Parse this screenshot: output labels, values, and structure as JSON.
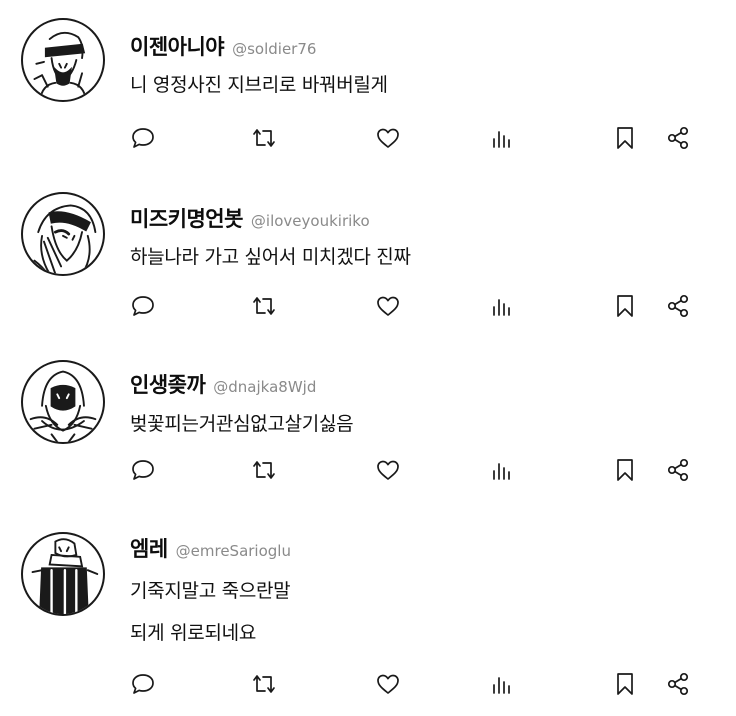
{
  "feed": {
    "posts": [
      {
        "display_name": "이젠아니야",
        "handle": "@soldier76",
        "lines": [
          "니 영정사진 지브리로 바꿔버릴게"
        ]
      },
      {
        "display_name": "미즈키명언봇",
        "handle": "@iloveyoukiriko",
        "lines": [
          "하늘나라 가고 싶어서 미치겠다 진짜"
        ]
      },
      {
        "display_name": "인생좆까",
        "handle": "@dnajka8Wjd",
        "lines": [
          "벚꽃피는거관심없고살기싫음"
        ]
      },
      {
        "display_name": "엠레",
        "handle": "@emreSarioglu",
        "lines": [
          "기죽지말고 죽으란말",
          "되게 위로되네요"
        ]
      }
    ]
  },
  "icons": {
    "reply": "speech-bubble-icon",
    "repost": "repost-arrows-icon",
    "like": "heart-icon",
    "views": "bar-chart-icon",
    "bookmark": "bookmark-icon",
    "share": "share-icon"
  },
  "colors": {
    "text": "#111111",
    "handle": "#8a8a8a",
    "background": "#ffffff",
    "icon_stroke": "#1a1a1a"
  }
}
